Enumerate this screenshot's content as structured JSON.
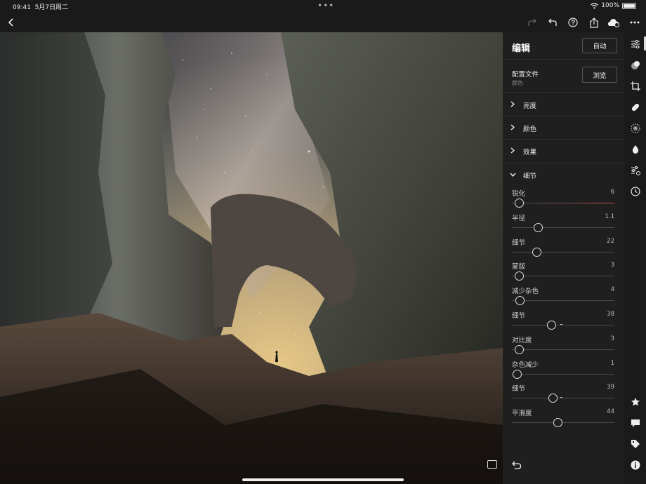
{
  "status": {
    "time": "09:41",
    "date": "5月7日周二",
    "battery": "100%"
  },
  "panel": {
    "title": "编辑",
    "auto_label": "自动",
    "profile_label": "配置文件",
    "profile_value": "颜色",
    "browse_label": "浏览",
    "sections": [
      "亮度",
      "颜色",
      "效果"
    ],
    "detail_title": "细节",
    "sliders": [
      {
        "label": "锐化",
        "value": "6",
        "fraction": 0.07,
        "active": true
      },
      {
        "label": "半径",
        "value": "1.1",
        "fraction": 0.26
      },
      {
        "label": "细节",
        "value": "22",
        "fraction": 0.24
      },
      {
        "label": "蒙版",
        "value": "3",
        "fraction": 0.07
      },
      {
        "label": "减少杂色",
        "value": "4",
        "fraction": 0.08
      },
      {
        "label": "细节",
        "value": "38",
        "fraction": 0.39,
        "tick": 0.47
      },
      {
        "label": "对比度",
        "value": "3",
        "fraction": 0.07
      },
      {
        "label": "杂色减少",
        "value": "1",
        "fraction": 0.05
      },
      {
        "label": "细节",
        "value": "39",
        "fraction": 0.4,
        "tick": 0.47
      },
      {
        "label": "平滑度",
        "value": "44",
        "fraction": 0.45
      }
    ]
  },
  "rail_icons": [
    "sliders-icon",
    "color-mix-icon",
    "crop-icon",
    "healing-brush-icon",
    "vignette-icon",
    "droplet-icon",
    "presets-icon",
    "history-icon",
    "star-icon",
    "comment-icon",
    "tag-icon",
    "info-icon"
  ]
}
